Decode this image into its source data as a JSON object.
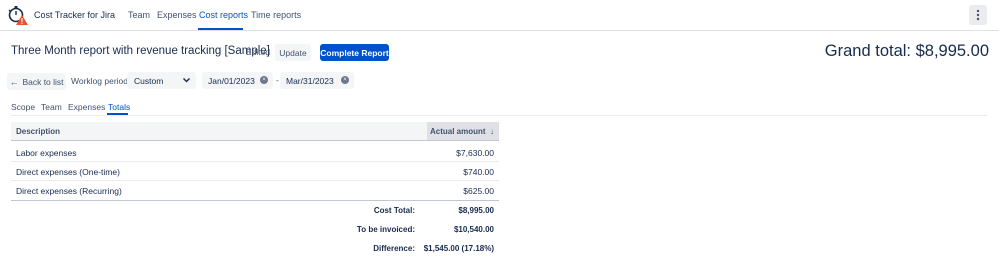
{
  "app": {
    "name": "Cost Tracker for Jira"
  },
  "nav": {
    "team": "Team",
    "expenses": "Expenses",
    "cost_reports": "Cost reports",
    "time_reports": "Time reports"
  },
  "header": {
    "title": "Three Month report with revenue tracking [Sample]",
    "status": "Edited",
    "update_label": "Update",
    "complete_label": "Complete Report",
    "grand_total": "Grand total: $8,995.00"
  },
  "filters": {
    "back_label": "Back to list",
    "period_label": "Worklog period:",
    "period_value": "Custom",
    "start_date": "Jan/01/2023",
    "separator": "-",
    "end_date": "Mar/31/2023"
  },
  "tabs": {
    "scope": "Scope",
    "team": "Team",
    "expenses": "Expenses",
    "totals": "Totals"
  },
  "table": {
    "col_description": "Description",
    "col_amount": "Actual amount",
    "rows": [
      {
        "description": "Labor expenses",
        "amount": "$7,630.00"
      },
      {
        "description": "Direct expenses (One-time)",
        "amount": "$740.00"
      },
      {
        "description": "Direct expenses (Recurring)",
        "amount": "$625.00"
      }
    ]
  },
  "summary": {
    "cost_total_label": "Cost Total:",
    "cost_total_value": "$8,995.00",
    "invoiced_label": "To be invoiced:",
    "invoiced_value": "$10,540.00",
    "difference_label": "Difference:",
    "difference_value": "$1,545.00 (17.18%)"
  },
  "colors": {
    "accent": "#0052cc",
    "logo_warning": "#e8522f"
  },
  "icons": {
    "logo": "stopwatch-warning-icon",
    "more": "more-vertical-icon",
    "back": "arrow-left-icon",
    "dropdown": "chevron-down-icon",
    "clear": "clear-icon",
    "sort": "arrow-down-icon"
  }
}
